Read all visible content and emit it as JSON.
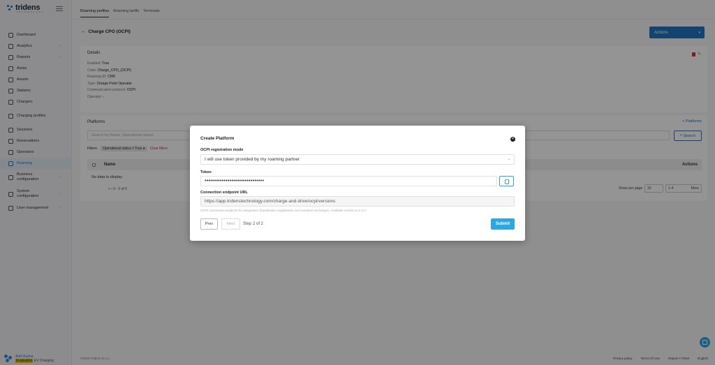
{
  "brand": {
    "name": "tridens",
    "tagline": "TECHNOLOGY"
  },
  "sidebar": {
    "items": [
      {
        "label": "Dashboard",
        "icon": "dashboard-icon",
        "chevron": false
      },
      {
        "label": "Analytics",
        "icon": "analytics-icon",
        "chevron": true
      },
      {
        "label": "Reports",
        "icon": "reports-icon",
        "chevron": true
      },
      {
        "label": "Areas",
        "icon": "areas-icon",
        "chevron": false
      },
      {
        "label": "Assets",
        "icon": "assets-icon",
        "chevron": false
      },
      {
        "label": "Stations",
        "icon": "stations-icon",
        "chevron": false
      },
      {
        "label": "Chargers",
        "icon": "chargers-icon",
        "chevron": false
      },
      {
        "label": "Charging profiles",
        "icon": "charging-profiles-icon",
        "chevron": false
      },
      {
        "label": "Sessions",
        "icon": "sessions-icon",
        "chevron": false
      },
      {
        "label": "Reservations",
        "icon": "reservations-icon",
        "chevron": false
      },
      {
        "label": "Operators",
        "icon": "operators-icon",
        "chevron": false
      },
      {
        "label": "Roaming",
        "icon": "roaming-icon",
        "chevron": false,
        "active": true
      },
      {
        "label": "Business configuration",
        "icon": "business-icon",
        "chevron": true
      },
      {
        "label": "System configuration",
        "icon": "system-icon",
        "chevron": true
      },
      {
        "label": "User management",
        "icon": "users-icon",
        "chevron": true
      }
    ],
    "user": {
      "name": "Aleš Budna",
      "role_badge": "Evaluation",
      "role_suffix": "EV Charging"
    }
  },
  "tabs": [
    "Roaming profiles",
    "Roaming tariffs",
    "Terminals"
  ],
  "page": {
    "back_arrow": "←",
    "title": "Charge CPO (OCPI)",
    "actions_label": "Actions"
  },
  "details": {
    "title": "Details",
    "rows": [
      {
        "k": "Enabled:",
        "v": "True"
      },
      {
        "k": "Code:",
        "v": "Charge_CPO_(OCPI)"
      },
      {
        "k": "Roaming ID:",
        "v": "CHR"
      },
      {
        "k": "Type:",
        "v": "Charge Point Operator"
      },
      {
        "k": "Communication protocol:",
        "v": "OCPI"
      },
      {
        "k": "Operator:",
        "v": "-"
      }
    ]
  },
  "platforms": {
    "title": "Platforms",
    "add_label": "+ Platforms",
    "search_placeholder": "Search by Name, Operational status",
    "search_button": "Search",
    "filters_label": "Filters:",
    "filter_chip": "Operational status = True",
    "clear_label": "Clear filters",
    "col_name": "Name",
    "col_actions": "Actions",
    "empty": "No data to display",
    "pager": "«  ‹  0 - 0 of 0",
    "rows_per_page_label": "Rows per page",
    "rows_per_page_value": "10",
    "page_jump": "1-4",
    "more_label": "More"
  },
  "footer": {
    "copyright": "©2024 Tridens d.o.o.",
    "links": [
      "Privacy policy",
      "Terms Of Use",
      "Report A Ticket",
      "English"
    ]
  },
  "modal": {
    "title": "Create Platform",
    "mode_label": "OCPI registration mode",
    "mode_value": "I will use token provided by my roaming partner",
    "token_label": "Token",
    "token_value": "•••••••••••••••••••••••••••••••",
    "url_label": "Connection endpoint URL",
    "url_value": "https://app.tridenstechnology.com/charge-and-drive/ocpi/versions",
    "hint": "OCPI connection endpoint for integration (handshake (registration and versions exchange). Available version is 2.2.1",
    "prev": "Prev",
    "next": "Next",
    "step": "Step 2 of 2",
    "submit": "Submit"
  },
  "colors": {
    "accent": "#2176c1",
    "submit": "#2aa8e6",
    "danger": "#d2323a"
  }
}
